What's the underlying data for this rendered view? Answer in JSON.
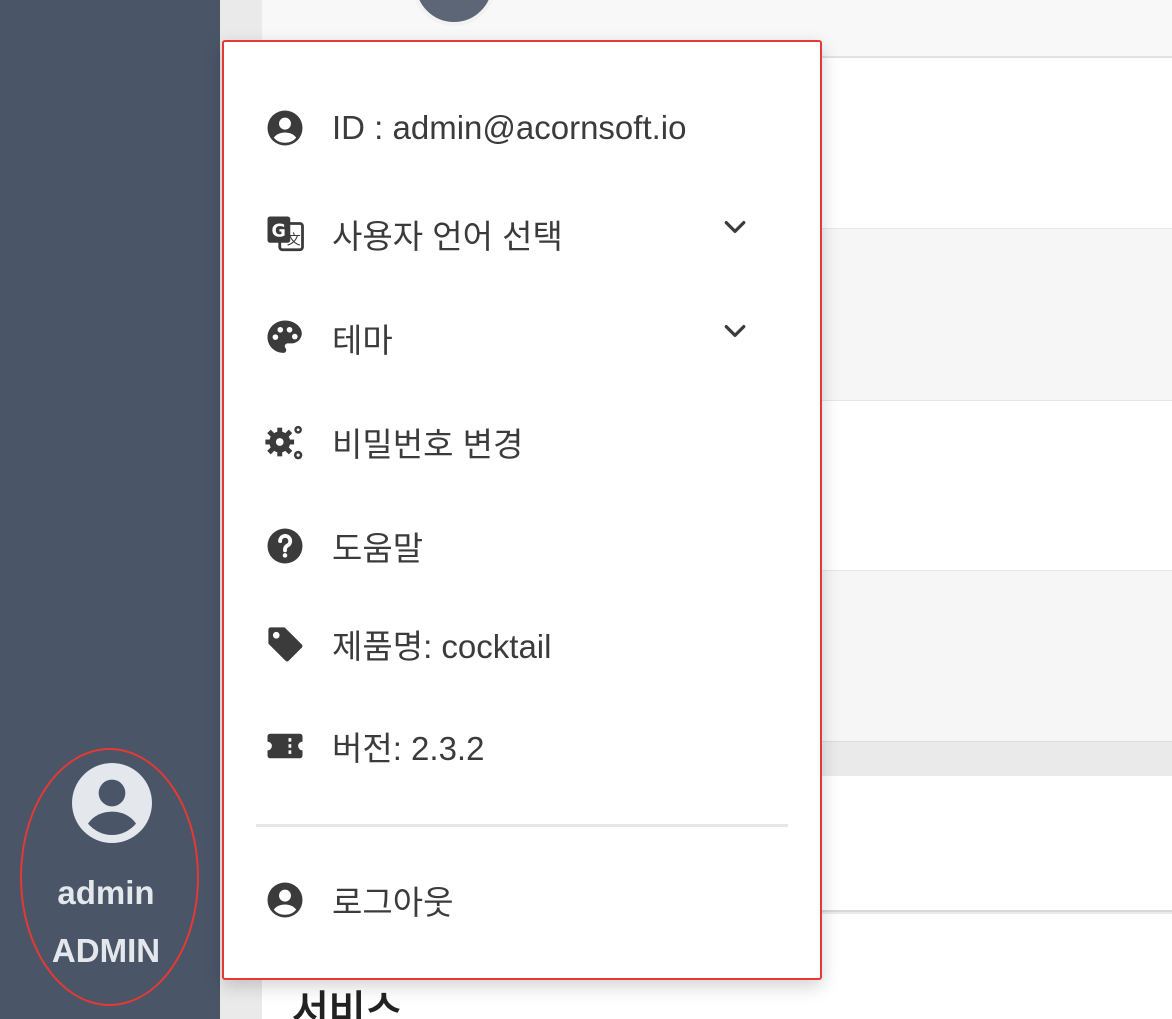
{
  "sidebar": {
    "user": {
      "name": "admin",
      "role": "ADMIN"
    }
  },
  "user_menu": {
    "items": [
      {
        "label": "ID : admin@acornsoft.io",
        "icon": "account-circle-icon"
      },
      {
        "label": "사용자 언어 선택",
        "icon": "translate-icon",
        "has_submenu": true
      },
      {
        "label": "테마",
        "icon": "palette-icon",
        "has_submenu": true
      },
      {
        "label": "비밀번호 변경",
        "icon": "gears-icon"
      },
      {
        "label": "도움말",
        "icon": "help-circle-icon"
      },
      {
        "label": "제품명: cocktail",
        "icon": "tag-icon"
      },
      {
        "label": "버전: 2.3.2",
        "icon": "ticket-icon"
      }
    ],
    "logout_label": "로그아웃",
    "logout_icon": "account-circle-icon"
  },
  "main": {
    "section_title": "서비스"
  },
  "colors": {
    "sidebar_bg": "#4a5567",
    "highlight_border": "#e53935",
    "icon": "#3b3b3b"
  }
}
